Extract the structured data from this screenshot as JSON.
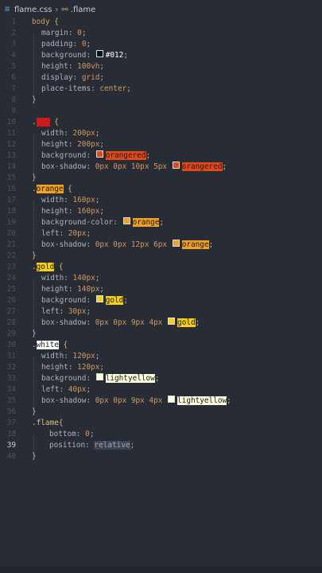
{
  "breadcrumb": {
    "file": "flame.css",
    "symbol": ".flame"
  },
  "lines": [
    {
      "n": "1"
    },
    {
      "n": "2"
    },
    {
      "n": "3"
    },
    {
      "n": "4"
    },
    {
      "n": "5"
    },
    {
      "n": "6"
    },
    {
      "n": "7"
    },
    {
      "n": "8"
    },
    {
      "n": "9"
    },
    {
      "n": "10"
    },
    {
      "n": "11"
    },
    {
      "n": "12"
    },
    {
      "n": "13"
    },
    {
      "n": "14"
    },
    {
      "n": "15"
    },
    {
      "n": "16"
    },
    {
      "n": "17"
    },
    {
      "n": "18"
    },
    {
      "n": "19"
    },
    {
      "n": "20"
    },
    {
      "n": "21"
    },
    {
      "n": "22"
    },
    {
      "n": "23"
    },
    {
      "n": "24"
    },
    {
      "n": "25"
    },
    {
      "n": "26"
    },
    {
      "n": "27"
    },
    {
      "n": "28"
    },
    {
      "n": "29"
    },
    {
      "n": "30"
    },
    {
      "n": "31"
    },
    {
      "n": "32"
    },
    {
      "n": "33"
    },
    {
      "n": "34"
    },
    {
      "n": "35"
    },
    {
      "n": "36"
    },
    {
      "n": "37"
    },
    {
      "n": "38"
    },
    {
      "n": "39"
    },
    {
      "n": "40"
    }
  ],
  "code": {
    "l1": {
      "sel": "body",
      "open": " {"
    },
    "l2": {
      "prop": "margin: ",
      "val": "0",
      ";": ";"
    },
    "l3": {
      "prop": "padding: ",
      "val": "0",
      ";": ";"
    },
    "l4": {
      "prop": "background: ",
      "val": "#012",
      ";": ";"
    },
    "l5": {
      "prop": "height: ",
      "val": "100vh",
      ";": ";"
    },
    "l6": {
      "prop": "display: ",
      "val": "grid",
      ";": ";"
    },
    "l7": {
      "prop": "place-items: ",
      "val": "center",
      ";": ";"
    },
    "l8": {
      "close": "}"
    },
    "l10": {
      "dot": ".",
      "sel": "red",
      "open": " {"
    },
    "l11": {
      "prop": "width: ",
      "val": "200px",
      ";": ";"
    },
    "l12": {
      "prop": "height: ",
      "val": "200px",
      ";": ";"
    },
    "l13": {
      "prop": "background: ",
      "val": "orangered",
      ";": ";"
    },
    "l14": {
      "prop": "box-shadow: ",
      "val1": "0px 0px 10px 5px ",
      "val": "orangered",
      ";": ";"
    },
    "l15": {
      "close": "}"
    },
    "l16": {
      "dot": ".",
      "sel": "orange",
      "open": " {"
    },
    "l17": {
      "prop": "width: ",
      "val": "160px",
      ";": ";"
    },
    "l18": {
      "prop": "height: ",
      "val": "160px",
      ";": ";"
    },
    "l19": {
      "prop": "background-color: ",
      "val": "orange",
      ";": ";"
    },
    "l20": {
      "prop": "left: ",
      "val": "20px",
      ";": ";"
    },
    "l21": {
      "prop": "box-shadow: ",
      "val1": "0px 0px 12px 6px ",
      "val": "orange",
      ";": ";"
    },
    "l22": {
      "close": "}"
    },
    "l23": {
      "dot": ".",
      "sel": "gold",
      "open": " {"
    },
    "l24": {
      "prop": "width: ",
      "val": "140px",
      ";": ";"
    },
    "l25": {
      "prop": "height: ",
      "val": "140px",
      ";": ";"
    },
    "l26": {
      "prop": "background: ",
      "val": "gold",
      ";": ";"
    },
    "l27": {
      "prop": "left: ",
      "val": "30px",
      ";": ";"
    },
    "l28": {
      "prop": "box-shadow: ",
      "val1": "0px 0px 9px 4px ",
      "val": "gold",
      ";": ";"
    },
    "l29": {
      "close": "}"
    },
    "l30": {
      "dot": ".",
      "sel": "white",
      "open": " {"
    },
    "l31": {
      "prop": "width: ",
      "val": "120px",
      ";": ";"
    },
    "l32": {
      "prop": "height: ",
      "val": "120px",
      ";": ";"
    },
    "l33": {
      "prop": "background: ",
      "val": "lightyellow",
      ";": ";"
    },
    "l34": {
      "prop": "left: ",
      "val": "40px",
      ";": ";"
    },
    "l35": {
      "prop": "box-shadow: ",
      "val1": "0px 0px 9px 4px ",
      "val": "lightyellow",
      ";": ";"
    },
    "l36": {
      "close": "}"
    },
    "l37": {
      "sel": ".flame",
      "open": "{"
    },
    "l38": {
      "prop": "bottom: ",
      "val": "0",
      ";": ";"
    },
    "l39": {
      "prop": "position: ",
      "val": "relative",
      ";": ";"
    },
    "l40": {
      "close": "}"
    }
  },
  "colors": {
    "background": "#282c34",
    "orangered": "#e34816",
    "orange": "#f0a125",
    "gold": "#f5cf1a",
    "lightyellow": "#ffffe0",
    "red": "#cc1a1a"
  }
}
